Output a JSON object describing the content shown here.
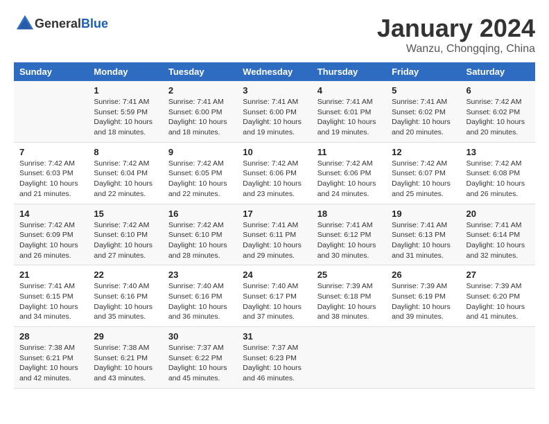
{
  "logo": {
    "text_general": "General",
    "text_blue": "Blue"
  },
  "header": {
    "month": "January 2024",
    "location": "Wanzu, Chongqing, China"
  },
  "weekdays": [
    "Sunday",
    "Monday",
    "Tuesday",
    "Wednesday",
    "Thursday",
    "Friday",
    "Saturday"
  ],
  "weeks": [
    [
      {
        "day": "",
        "info": ""
      },
      {
        "day": "1",
        "info": "Sunrise: 7:41 AM\nSunset: 5:59 PM\nDaylight: 10 hours\nand 18 minutes."
      },
      {
        "day": "2",
        "info": "Sunrise: 7:41 AM\nSunset: 6:00 PM\nDaylight: 10 hours\nand 18 minutes."
      },
      {
        "day": "3",
        "info": "Sunrise: 7:41 AM\nSunset: 6:00 PM\nDaylight: 10 hours\nand 19 minutes."
      },
      {
        "day": "4",
        "info": "Sunrise: 7:41 AM\nSunset: 6:01 PM\nDaylight: 10 hours\nand 19 minutes."
      },
      {
        "day": "5",
        "info": "Sunrise: 7:41 AM\nSunset: 6:02 PM\nDaylight: 10 hours\nand 20 minutes."
      },
      {
        "day": "6",
        "info": "Sunrise: 7:42 AM\nSunset: 6:02 PM\nDaylight: 10 hours\nand 20 minutes."
      }
    ],
    [
      {
        "day": "7",
        "info": "Sunrise: 7:42 AM\nSunset: 6:03 PM\nDaylight: 10 hours\nand 21 minutes."
      },
      {
        "day": "8",
        "info": "Sunrise: 7:42 AM\nSunset: 6:04 PM\nDaylight: 10 hours\nand 22 minutes."
      },
      {
        "day": "9",
        "info": "Sunrise: 7:42 AM\nSunset: 6:05 PM\nDaylight: 10 hours\nand 22 minutes."
      },
      {
        "day": "10",
        "info": "Sunrise: 7:42 AM\nSunset: 6:06 PM\nDaylight: 10 hours\nand 23 minutes."
      },
      {
        "day": "11",
        "info": "Sunrise: 7:42 AM\nSunset: 6:06 PM\nDaylight: 10 hours\nand 24 minutes."
      },
      {
        "day": "12",
        "info": "Sunrise: 7:42 AM\nSunset: 6:07 PM\nDaylight: 10 hours\nand 25 minutes."
      },
      {
        "day": "13",
        "info": "Sunrise: 7:42 AM\nSunset: 6:08 PM\nDaylight: 10 hours\nand 26 minutes."
      }
    ],
    [
      {
        "day": "14",
        "info": "Sunrise: 7:42 AM\nSunset: 6:09 PM\nDaylight: 10 hours\nand 26 minutes."
      },
      {
        "day": "15",
        "info": "Sunrise: 7:42 AM\nSunset: 6:10 PM\nDaylight: 10 hours\nand 27 minutes."
      },
      {
        "day": "16",
        "info": "Sunrise: 7:42 AM\nSunset: 6:10 PM\nDaylight: 10 hours\nand 28 minutes."
      },
      {
        "day": "17",
        "info": "Sunrise: 7:41 AM\nSunset: 6:11 PM\nDaylight: 10 hours\nand 29 minutes."
      },
      {
        "day": "18",
        "info": "Sunrise: 7:41 AM\nSunset: 6:12 PM\nDaylight: 10 hours\nand 30 minutes."
      },
      {
        "day": "19",
        "info": "Sunrise: 7:41 AM\nSunset: 6:13 PM\nDaylight: 10 hours\nand 31 minutes."
      },
      {
        "day": "20",
        "info": "Sunrise: 7:41 AM\nSunset: 6:14 PM\nDaylight: 10 hours\nand 32 minutes."
      }
    ],
    [
      {
        "day": "21",
        "info": "Sunrise: 7:41 AM\nSunset: 6:15 PM\nDaylight: 10 hours\nand 34 minutes."
      },
      {
        "day": "22",
        "info": "Sunrise: 7:40 AM\nSunset: 6:16 PM\nDaylight: 10 hours\nand 35 minutes."
      },
      {
        "day": "23",
        "info": "Sunrise: 7:40 AM\nSunset: 6:16 PM\nDaylight: 10 hours\nand 36 minutes."
      },
      {
        "day": "24",
        "info": "Sunrise: 7:40 AM\nSunset: 6:17 PM\nDaylight: 10 hours\nand 37 minutes."
      },
      {
        "day": "25",
        "info": "Sunrise: 7:39 AM\nSunset: 6:18 PM\nDaylight: 10 hours\nand 38 minutes."
      },
      {
        "day": "26",
        "info": "Sunrise: 7:39 AM\nSunset: 6:19 PM\nDaylight: 10 hours\nand 39 minutes."
      },
      {
        "day": "27",
        "info": "Sunrise: 7:39 AM\nSunset: 6:20 PM\nDaylight: 10 hours\nand 41 minutes."
      }
    ],
    [
      {
        "day": "28",
        "info": "Sunrise: 7:38 AM\nSunset: 6:21 PM\nDaylight: 10 hours\nand 42 minutes."
      },
      {
        "day": "29",
        "info": "Sunrise: 7:38 AM\nSunset: 6:21 PM\nDaylight: 10 hours\nand 43 minutes."
      },
      {
        "day": "30",
        "info": "Sunrise: 7:37 AM\nSunset: 6:22 PM\nDaylight: 10 hours\nand 45 minutes."
      },
      {
        "day": "31",
        "info": "Sunrise: 7:37 AM\nSunset: 6:23 PM\nDaylight: 10 hours\nand 46 minutes."
      },
      {
        "day": "",
        "info": ""
      },
      {
        "day": "",
        "info": ""
      },
      {
        "day": "",
        "info": ""
      }
    ]
  ]
}
